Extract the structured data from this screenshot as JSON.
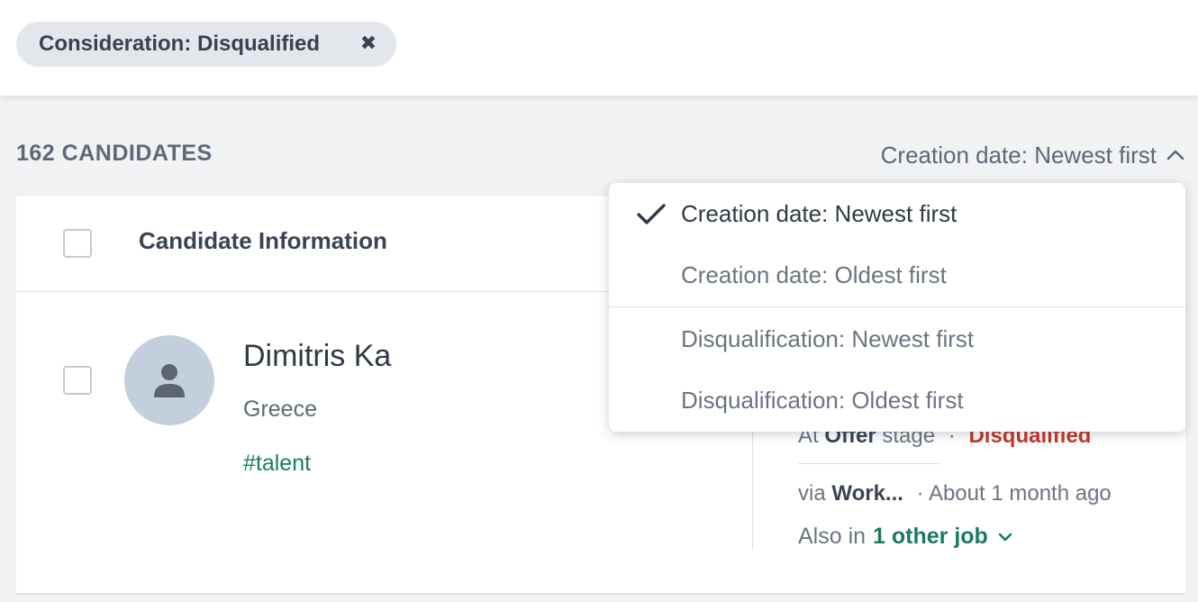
{
  "filter_chip": {
    "label": "Consideration: Disqualified",
    "close_glyph": "✖"
  },
  "list": {
    "count_label": "162 CANDIDATES"
  },
  "sort": {
    "current": "Creation date: Newest first",
    "options": [
      "Creation date: Newest first",
      "Creation date: Oldest first",
      "Disqualification: Newest first",
      "Disqualification: Oldest first"
    ]
  },
  "table": {
    "header": "Candidate Information"
  },
  "candidate": {
    "name": "Dimitris Ka",
    "location": "Greece",
    "tag": "#talent",
    "stage_prefix": "At",
    "stage_name": "Offer",
    "stage_suffix": "stage",
    "separator": "·",
    "status": "Disqualified",
    "source_prefix": "via",
    "source": "Work...",
    "time": "· About 1 month ago",
    "also_prefix": "Also in",
    "other_jobs": "1 other job"
  },
  "colors": {
    "accent_green": "#1b7a63",
    "disqualified_red": "#c4372b",
    "chip_bg": "#e3e7ec",
    "avatar_bg": "#c3cfdd"
  }
}
